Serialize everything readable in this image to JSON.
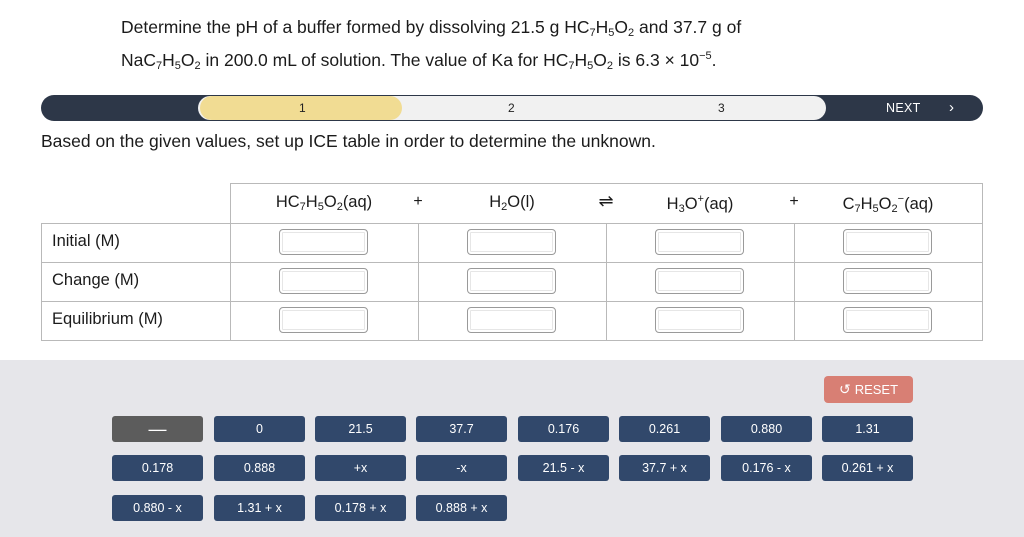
{
  "question": {
    "line1_html": "Determine the pH of a buffer formed by dissolving 21.5 g HC<sub>7</sub>H<sub>5</sub>O<sub>2</sub> and 37.7 g of",
    "line2_html": "NaC<sub>7</sub>H<sub>5</sub>O<sub>2</sub> in 200.0 mL of solution. The value of Ka for HC<sub>7</sub>H<sub>5</sub>O<sub>2</sub> is 6.3 × 10<sup>−5</sup>."
  },
  "progress": {
    "steps": [
      "1",
      "2",
      "3"
    ],
    "current_step": 1,
    "next_label": "NEXT",
    "next_icon": "chevron-right-icon",
    "next_glyph": "›"
  },
  "instruction": "Based on the given values, set up ICE table in order to determine the unknown.",
  "ice_table": {
    "species_html": [
      "HC<sub>7</sub>H<sub>5</sub>O<sub>2</sub>(aq)",
      "H<sub>2</sub>O(l)",
      "H<sub>3</sub>O<sup>+</sup>(aq)",
      "C<sub>7</sub>H<sub>5</sub>O<sub>2</sub><sup>−</sup>(aq)"
    ],
    "operators": [
      "+",
      "⇌",
      "+"
    ],
    "rows": [
      "Initial (M)",
      "Change (M)",
      "Equilibrium (M)"
    ]
  },
  "reset": {
    "label": "RESET",
    "icon": "undo-icon",
    "glyph": "↺"
  },
  "tiles": [
    [
      "—",
      "0",
      "21.5",
      "37.7",
      "0.176",
      "0.261",
      "0.880",
      "1.31"
    ],
    [
      "0.178",
      "0.888",
      "+x",
      "-x",
      "21.5 - x",
      "37.7 + x",
      "0.176 - x",
      "0.261 + x"
    ],
    [
      "0.880 - x",
      "1.31 + x",
      "0.178 + x",
      "0.888 + x"
    ]
  ],
  "colors": {
    "progress_bar": "#2d3748",
    "active_step": "#f1dc93",
    "tile": "#31486b",
    "tile_disabled": "#5c5c5c",
    "reset": "#d87f74",
    "tray": "#e6e6ea"
  }
}
